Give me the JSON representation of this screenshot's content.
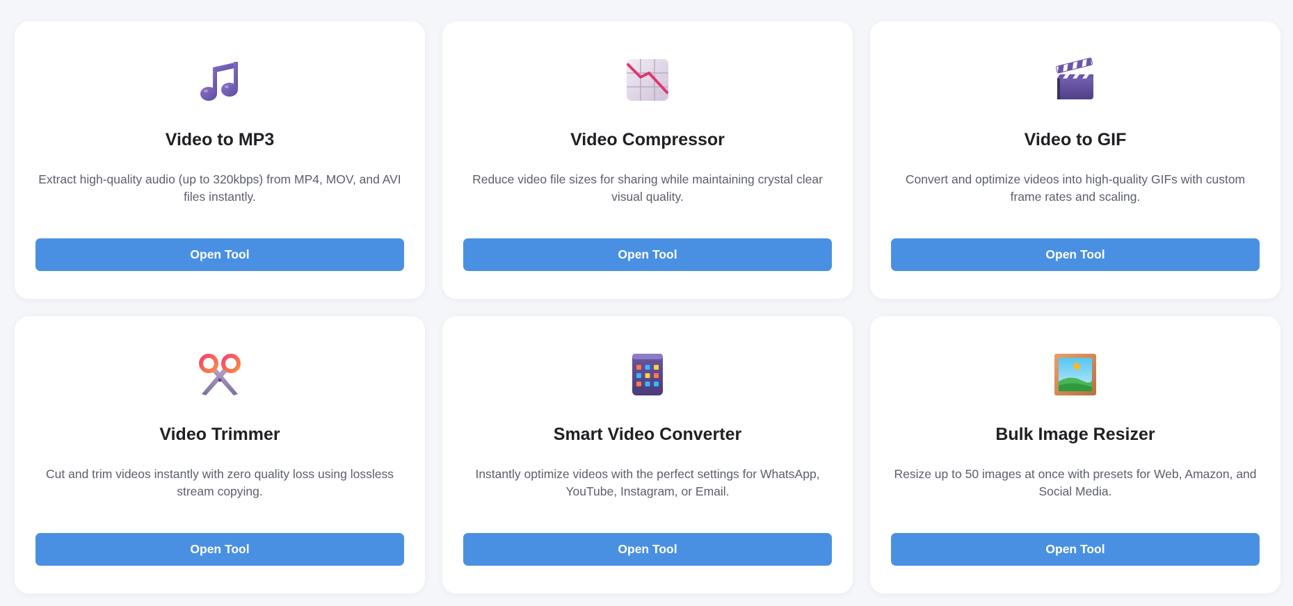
{
  "button_label": "Open Tool",
  "accent_color": "#4a90e2",
  "tools": [
    {
      "icon": "music-note-icon",
      "title": "Video to MP3",
      "description": "Extract high-quality audio (up to 320kbps) from MP4, MOV, and AVI files instantly."
    },
    {
      "icon": "chart-decreasing-icon",
      "title": "Video Compressor",
      "description": "Reduce video file sizes for sharing while maintaining crystal clear visual quality."
    },
    {
      "icon": "clapper-board-icon",
      "title": "Video to GIF",
      "description": "Convert and optimize videos into high-quality GIFs with custom frame rates and scaling."
    },
    {
      "icon": "scissors-icon",
      "title": "Video Trimmer",
      "description": "Cut and trim videos instantly with zero quality loss using lossless stream copying."
    },
    {
      "icon": "mobile-phone-icon",
      "title": "Smart Video Converter",
      "description": "Instantly optimize videos with the perfect settings for WhatsApp, YouTube, Instagram, or Email."
    },
    {
      "icon": "framed-picture-icon",
      "title": "Bulk Image Resizer",
      "description": "Resize up to 50 images at once with presets for Web, Amazon, and Social Media."
    }
  ]
}
